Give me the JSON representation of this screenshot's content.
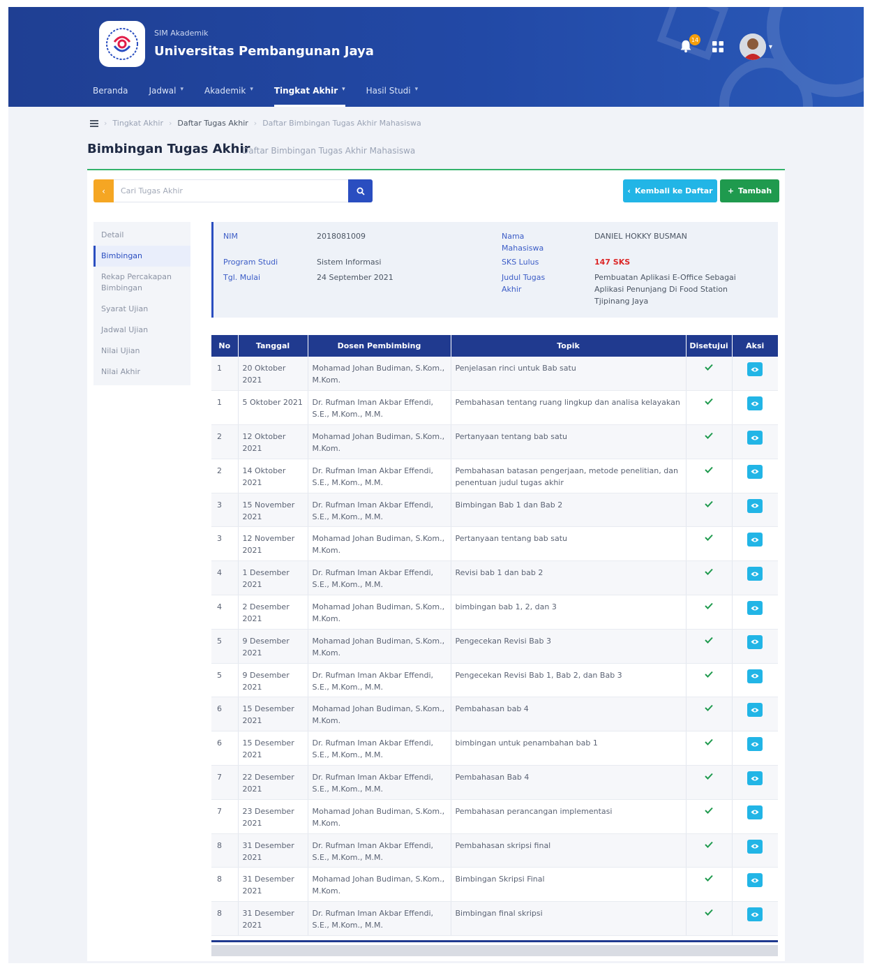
{
  "header": {
    "brand_sub": "SIM Akademik",
    "brand_title": "Universitas Pembangunan Jaya",
    "notif_count": "14",
    "nav": [
      {
        "label": "Beranda",
        "dropdown": false
      },
      {
        "label": "Jadwal",
        "dropdown": true
      },
      {
        "label": "Akademik",
        "dropdown": true
      },
      {
        "label": "Tingkat Akhir",
        "dropdown": true,
        "active": true
      },
      {
        "label": "Hasil Studi",
        "dropdown": true
      }
    ]
  },
  "breadcrumb": [
    "Tingkat Akhir",
    "Daftar Tugas Akhir",
    "Daftar Bimbingan Tugas Akhir Mahasiswa"
  ],
  "page": {
    "title": "Bimbingan Tugas Akhir",
    "subtitle": "Daftar Bimbingan Tugas Akhir Mahasiswa"
  },
  "search": {
    "placeholder": "Cari Tugas Akhir"
  },
  "buttons": {
    "back": "Kembali ke Daftar",
    "add": "Tambah"
  },
  "side_menu": [
    "Detail",
    "Bimbingan",
    "Rekap Percakapan Bimbingan",
    "Syarat Ujian",
    "Jadwal Ujian",
    "Nilai Ujian",
    "Nilai Akhir"
  ],
  "info": {
    "nim_label": "NIM",
    "nim": "2018081009",
    "nama_label": "Nama Mahasiswa",
    "nama": "DANIEL HOKKY BUSMAN",
    "prodi_label": "Program Studi",
    "prodi": "Sistem Informasi",
    "sks_label": "SKS Lulus",
    "sks": "147 SKS",
    "tgl_label": "Tgl. Mulai",
    "tgl": "24 September 2021",
    "judul_label": "Judul Tugas Akhir",
    "judul": "Pembuatan Aplikasi E-Office Sebagai Aplikasi Penunjang Di Food Station Tjipinang Jaya"
  },
  "table": {
    "headers": [
      "No",
      "Tanggal",
      "Dosen Pembimbing",
      "Topik",
      "Disetujui",
      "Aksi"
    ],
    "rows": [
      {
        "no": "1",
        "tanggal": "20 Oktober 2021",
        "dosen": "Mohamad Johan Budiman, S.Kom., M.Kom.",
        "topik": "Penjelasan rinci untuk Bab satu"
      },
      {
        "no": "1",
        "tanggal": "5 Oktober 2021",
        "dosen": "Dr. Rufman Iman Akbar Effendi, S.E., M.Kom., M.M.",
        "topik": "Pembahasan tentang ruang lingkup dan analisa kelayakan"
      },
      {
        "no": "2",
        "tanggal": "12 Oktober 2021",
        "dosen": "Mohamad Johan Budiman, S.Kom., M.Kom.",
        "topik": "Pertanyaan tentang bab satu"
      },
      {
        "no": "2",
        "tanggal": "14 Oktober 2021",
        "dosen": "Dr. Rufman Iman Akbar Effendi, S.E., M.Kom., M.M.",
        "topik": "Pembahasan batasan pengerjaan, metode penelitian, dan penentuan judul tugas akhir"
      },
      {
        "no": "3",
        "tanggal": "15 November 2021",
        "dosen": "Dr. Rufman Iman Akbar Effendi, S.E., M.Kom., M.M.",
        "topik": "Bimbingan Bab 1 dan Bab 2"
      },
      {
        "no": "3",
        "tanggal": "12 November 2021",
        "dosen": "Mohamad Johan Budiman, S.Kom., M.Kom.",
        "topik": "Pertanyaan tentang bab satu"
      },
      {
        "no": "4",
        "tanggal": "1 Desember 2021",
        "dosen": "Dr. Rufman Iman Akbar Effendi, S.E., M.Kom., M.M.",
        "topik": "Revisi bab 1 dan bab 2"
      },
      {
        "no": "4",
        "tanggal": "2 Desember 2021",
        "dosen": "Mohamad Johan Budiman, S.Kom., M.Kom.",
        "topik": "bimbingan bab 1, 2, dan 3"
      },
      {
        "no": "5",
        "tanggal": "9 Desember 2021",
        "dosen": "Mohamad Johan Budiman, S.Kom., M.Kom.",
        "topik": "Pengecekan Revisi Bab 3"
      },
      {
        "no": "5",
        "tanggal": "9 Desember 2021",
        "dosen": "Dr. Rufman Iman Akbar Effendi, S.E., M.Kom., M.M.",
        "topik": "Pengecekan Revisi Bab 1, Bab 2, dan Bab 3"
      },
      {
        "no": "6",
        "tanggal": "15 Desember 2021",
        "dosen": "Mohamad Johan Budiman, S.Kom., M.Kom.",
        "topik": "Pembahasan bab 4"
      },
      {
        "no": "6",
        "tanggal": "15 Desember 2021",
        "dosen": "Dr. Rufman Iman Akbar Effendi, S.E., M.Kom., M.M.",
        "topik": "bimbingan untuk penambahan bab 1"
      },
      {
        "no": "7",
        "tanggal": "22 Desember 2021",
        "dosen": "Dr. Rufman Iman Akbar Effendi, S.E., M.Kom., M.M.",
        "topik": "Pembahasan Bab 4"
      },
      {
        "no": "7",
        "tanggal": "23 Desember 2021",
        "dosen": "Mohamad Johan Budiman, S.Kom., M.Kom.",
        "topik": "Pembahasan perancangan implementasi"
      },
      {
        "no": "8",
        "tanggal": "31 Desember 2021",
        "dosen": "Dr. Rufman Iman Akbar Effendi, S.E., M.Kom., M.M.",
        "topik": "Pembahasan skripsi final"
      },
      {
        "no": "8",
        "tanggal": "31 Desember 2021",
        "dosen": "Mohamad Johan Budiman, S.Kom., M.Kom.",
        "topik": "Bimbingan Skripsi Final"
      },
      {
        "no": "8",
        "tanggal": "31 Desember 2021",
        "dosen": "Dr. Rufman Iman Akbar Effendi, S.E., M.Kom., M.M.",
        "topik": "Bimbingan final skripsi"
      }
    ]
  },
  "colors": {
    "header_bg": "#2249a6",
    "primary": "#2a4ec0",
    "table_header": "#203a8f",
    "accent_orange": "#f5a623",
    "info_cyan": "#22b5e6",
    "success_green": "#1f9a4e"
  },
  "icons": {
    "home": "bars-icon",
    "bell": "bell-icon",
    "apps": "grid-icon",
    "search": "search-icon",
    "back": "chevron-left-icon",
    "add": "plus-icon",
    "approved": "check-icon",
    "view": "eye-icon"
  }
}
